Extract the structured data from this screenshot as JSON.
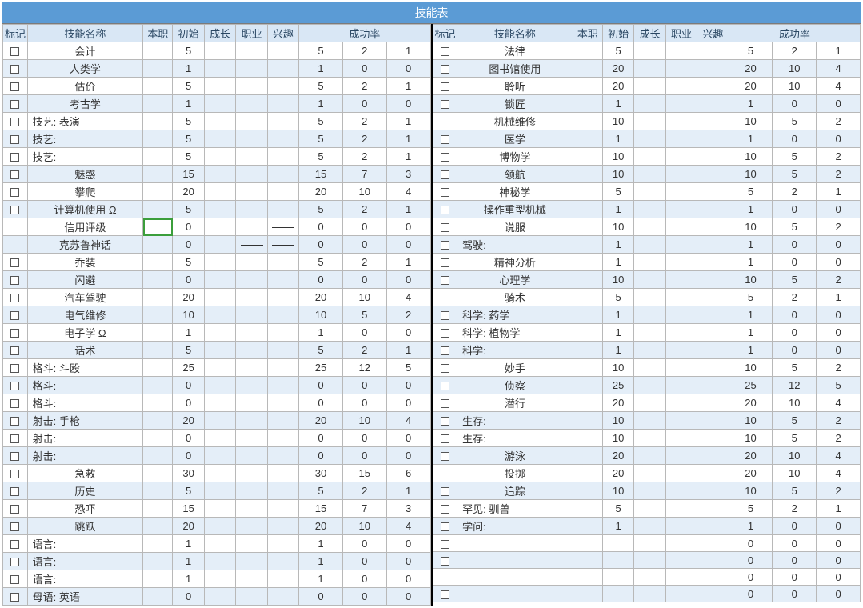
{
  "title": "技能表",
  "headers": {
    "mark": "标记",
    "name": "技能名称",
    "occ": "本职",
    "init": "初始",
    "grow": "成长",
    "prof": "职业",
    "interest": "兴趣",
    "success": "成功率"
  },
  "left": [
    {
      "chk": true,
      "name": "会计",
      "align": "c",
      "init": 5,
      "s1": 5,
      "s2": 2,
      "s3": 1
    },
    {
      "chk": true,
      "name": "人类学",
      "align": "c",
      "init": 1,
      "s1": 1,
      "s2": 0,
      "s3": 0
    },
    {
      "chk": true,
      "name": "估价",
      "align": "c",
      "init": 5,
      "s1": 5,
      "s2": 2,
      "s3": 1
    },
    {
      "chk": true,
      "name": "考古学",
      "align": "c",
      "init": 1,
      "s1": 1,
      "s2": 0,
      "s3": 0
    },
    {
      "chk": true,
      "name": "技艺: 表演",
      "align": "l",
      "init": 5,
      "s1": 5,
      "s2": 2,
      "s3": 1
    },
    {
      "chk": true,
      "name": "技艺:",
      "align": "l",
      "init": 5,
      "s1": 5,
      "s2": 2,
      "s3": 1
    },
    {
      "chk": true,
      "name": "技艺:",
      "align": "l",
      "init": 5,
      "s1": 5,
      "s2": 2,
      "s3": 1
    },
    {
      "chk": true,
      "name": "魅惑",
      "align": "c",
      "init": 15,
      "s1": 15,
      "s2": 7,
      "s3": 3
    },
    {
      "chk": true,
      "name": "攀爬",
      "align": "c",
      "init": 20,
      "s1": 20,
      "s2": 10,
      "s3": 4
    },
    {
      "chk": true,
      "name": "计算机使用 Ω",
      "align": "c",
      "init": 5,
      "s1": 5,
      "s2": 2,
      "s3": 1
    },
    {
      "chk": false,
      "name": "信用评级",
      "align": "c",
      "init": 0,
      "dashInt": true,
      "hl": true,
      "s1": 0,
      "s2": 0,
      "s3": 0
    },
    {
      "chk": false,
      "name": "克苏鲁神话",
      "align": "c",
      "init": 0,
      "dashProf": true,
      "dashInt": true,
      "s1": 0,
      "s2": 0,
      "s3": 0
    },
    {
      "chk": true,
      "name": "乔装",
      "align": "c",
      "init": 5,
      "s1": 5,
      "s2": 2,
      "s3": 1
    },
    {
      "chk": true,
      "name": "闪避",
      "align": "c",
      "init": 0,
      "s1": 0,
      "s2": 0,
      "s3": 0
    },
    {
      "chk": true,
      "name": "汽车驾驶",
      "align": "c",
      "init": 20,
      "s1": 20,
      "s2": 10,
      "s3": 4
    },
    {
      "chk": true,
      "name": "电气维修",
      "align": "c",
      "init": 10,
      "s1": 10,
      "s2": 5,
      "s3": 2
    },
    {
      "chk": true,
      "name": "电子学 Ω",
      "align": "c",
      "init": 1,
      "s1": 1,
      "s2": 0,
      "s3": 0
    },
    {
      "chk": true,
      "name": "话术",
      "align": "c",
      "init": 5,
      "s1": 5,
      "s2": 2,
      "s3": 1
    },
    {
      "chk": true,
      "name": "格斗: 斗殴",
      "align": "l",
      "init": 25,
      "s1": 25,
      "s2": 12,
      "s3": 5
    },
    {
      "chk": true,
      "name": "格斗:",
      "align": "l",
      "init": 0,
      "s1": 0,
      "s2": 0,
      "s3": 0
    },
    {
      "chk": true,
      "name": "格斗:",
      "align": "l",
      "init": 0,
      "s1": 0,
      "s2": 0,
      "s3": 0
    },
    {
      "chk": true,
      "name": "射击: 手枪",
      "align": "l",
      "init": 20,
      "s1": 20,
      "s2": 10,
      "s3": 4
    },
    {
      "chk": true,
      "name": "射击:",
      "align": "l",
      "init": 0,
      "s1": 0,
      "s2": 0,
      "s3": 0
    },
    {
      "chk": true,
      "name": "射击:",
      "align": "l",
      "init": 0,
      "s1": 0,
      "s2": 0,
      "s3": 0
    },
    {
      "chk": true,
      "name": "急救",
      "align": "c",
      "init": 30,
      "s1": 30,
      "s2": 15,
      "s3": 6
    },
    {
      "chk": true,
      "name": "历史",
      "align": "c",
      "init": 5,
      "s1": 5,
      "s2": 2,
      "s3": 1
    },
    {
      "chk": true,
      "name": "恐吓",
      "align": "c",
      "init": 15,
      "s1": 15,
      "s2": 7,
      "s3": 3
    },
    {
      "chk": true,
      "name": "跳跃",
      "align": "c",
      "init": 20,
      "s1": 20,
      "s2": 10,
      "s3": 4
    },
    {
      "chk": true,
      "name": "语言:",
      "align": "l",
      "init": 1,
      "s1": 1,
      "s2": 0,
      "s3": 0
    },
    {
      "chk": true,
      "name": "语言:",
      "align": "l",
      "init": 1,
      "s1": 1,
      "s2": 0,
      "s3": 0
    },
    {
      "chk": true,
      "name": "语言:",
      "align": "l",
      "init": 1,
      "s1": 1,
      "s2": 0,
      "s3": 0
    },
    {
      "chk": true,
      "name": "母语: 英语",
      "align": "l",
      "init": 0,
      "s1": 0,
      "s2": 0,
      "s3": 0
    }
  ],
  "right": [
    {
      "chk": true,
      "name": "法律",
      "align": "c",
      "init": 5,
      "s1": 5,
      "s2": 2,
      "s3": 1
    },
    {
      "chk": true,
      "name": "图书馆使用",
      "align": "c",
      "init": 20,
      "s1": 20,
      "s2": 10,
      "s3": 4
    },
    {
      "chk": true,
      "name": "聆听",
      "align": "c",
      "init": 20,
      "s1": 20,
      "s2": 10,
      "s3": 4
    },
    {
      "chk": true,
      "name": "锁匠",
      "align": "c",
      "init": 1,
      "s1": 1,
      "s2": 0,
      "s3": 0
    },
    {
      "chk": true,
      "name": "机械维修",
      "align": "c",
      "init": 10,
      "s1": 10,
      "s2": 5,
      "s3": 2
    },
    {
      "chk": true,
      "name": "医学",
      "align": "c",
      "init": 1,
      "s1": 1,
      "s2": 0,
      "s3": 0
    },
    {
      "chk": true,
      "name": "博物学",
      "align": "c",
      "init": 10,
      "s1": 10,
      "s2": 5,
      "s3": 2
    },
    {
      "chk": true,
      "name": "领航",
      "align": "c",
      "init": 10,
      "s1": 10,
      "s2": 5,
      "s3": 2
    },
    {
      "chk": true,
      "name": "神秘学",
      "align": "c",
      "init": 5,
      "s1": 5,
      "s2": 2,
      "s3": 1
    },
    {
      "chk": true,
      "name": "操作重型机械",
      "align": "c",
      "init": 1,
      "s1": 1,
      "s2": 0,
      "s3": 0
    },
    {
      "chk": true,
      "name": "说服",
      "align": "c",
      "init": 10,
      "s1": 10,
      "s2": 5,
      "s3": 2
    },
    {
      "chk": true,
      "name": "驾驶:",
      "align": "l",
      "init": 1,
      "s1": 1,
      "s2": 0,
      "s3": 0
    },
    {
      "chk": true,
      "name": "精神分析",
      "align": "c",
      "init": 1,
      "s1": 1,
      "s2": 0,
      "s3": 0
    },
    {
      "chk": true,
      "name": "心理学",
      "align": "c",
      "init": 10,
      "s1": 10,
      "s2": 5,
      "s3": 2
    },
    {
      "chk": true,
      "name": "骑术",
      "align": "c",
      "init": 5,
      "s1": 5,
      "s2": 2,
      "s3": 1
    },
    {
      "chk": true,
      "name": "科学: 药学",
      "align": "l",
      "init": 1,
      "s1": 1,
      "s2": 0,
      "s3": 0
    },
    {
      "chk": true,
      "name": "科学: 植物学",
      "align": "l",
      "init": 1,
      "s1": 1,
      "s2": 0,
      "s3": 0
    },
    {
      "chk": true,
      "name": "科学:",
      "align": "l",
      "init": 1,
      "s1": 1,
      "s2": 0,
      "s3": 0
    },
    {
      "chk": true,
      "name": "妙手",
      "align": "c",
      "init": 10,
      "s1": 10,
      "s2": 5,
      "s3": 2
    },
    {
      "chk": true,
      "name": "侦察",
      "align": "c",
      "init": 25,
      "s1": 25,
      "s2": 12,
      "s3": 5
    },
    {
      "chk": true,
      "name": "潜行",
      "align": "c",
      "init": 20,
      "s1": 20,
      "s2": 10,
      "s3": 4
    },
    {
      "chk": true,
      "name": "生存:",
      "align": "l",
      "init": 10,
      "s1": 10,
      "s2": 5,
      "s3": 2
    },
    {
      "chk": true,
      "name": "生存:",
      "align": "l",
      "init": 10,
      "s1": 10,
      "s2": 5,
      "s3": 2
    },
    {
      "chk": true,
      "name": "游泳",
      "align": "c",
      "init": 20,
      "s1": 20,
      "s2": 10,
      "s3": 4
    },
    {
      "chk": true,
      "name": "投掷",
      "align": "c",
      "init": 20,
      "s1": 20,
      "s2": 10,
      "s3": 4
    },
    {
      "chk": true,
      "name": "追踪",
      "align": "c",
      "init": 10,
      "s1": 10,
      "s2": 5,
      "s3": 2
    },
    {
      "chk": true,
      "name": "罕见: 驯兽",
      "align": "l",
      "init": 5,
      "s1": 5,
      "s2": 2,
      "s3": 1
    },
    {
      "chk": true,
      "name": "学问:",
      "align": "l",
      "init": 1,
      "s1": 1,
      "s2": 0,
      "s3": 0
    },
    {
      "chk": true,
      "name": "",
      "align": "c",
      "init": "",
      "s1": 0,
      "s2": 0,
      "s3": 0
    },
    {
      "chk": true,
      "name": "",
      "align": "c",
      "init": "",
      "s1": 0,
      "s2": 0,
      "s3": 0
    },
    {
      "chk": true,
      "name": "",
      "align": "c",
      "init": "",
      "s1": 0,
      "s2": 0,
      "s3": 0
    },
    {
      "chk": true,
      "name": "",
      "align": "c",
      "init": "",
      "s1": 0,
      "s2": 0,
      "s3": 0
    }
  ]
}
